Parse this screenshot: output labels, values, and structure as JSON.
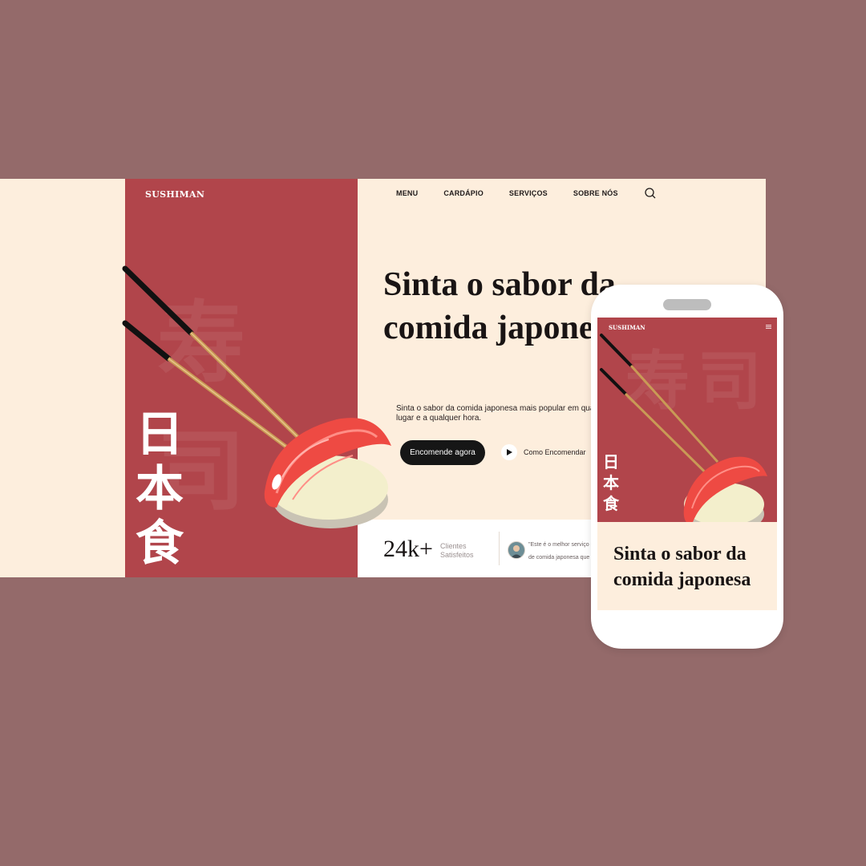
{
  "desktop": {
    "brand": "SUSHIMAN",
    "nav": [
      "MENU",
      "CARDÁPIO",
      "SERVIÇOS",
      "SOBRE NÓS"
    ],
    "search_icon": "search-icon",
    "kanji": "日本食",
    "watermark_kanji": "寿司",
    "hero": {
      "title": "Sinta o sabor da comida japonesa",
      "description_line1": "Sinta o sabor da comida japonesa mais popular em qualq",
      "description_line2": "lugar e a qualquer hora.",
      "cta_label": "Encomende agora",
      "howto_label": "Como Encomendar"
    },
    "stats": {
      "number": "24k+",
      "label_line1": "Clientes",
      "label_line2": "Satisfeitos",
      "testimonial_line1": "\"Este é o melhor serviço de",
      "testimonial_line2": "de comida japonesa que já"
    }
  },
  "mobile": {
    "brand": "SUSHIMAN",
    "menu_icon": "hamburger-icon",
    "kanji": "日本食",
    "title": "Sinta o sabor da comida japonesa"
  },
  "colors": {
    "background": "#946a6a",
    "accent_red": "#b1454b",
    "cream": "#fdeedd",
    "dark": "#161616"
  }
}
